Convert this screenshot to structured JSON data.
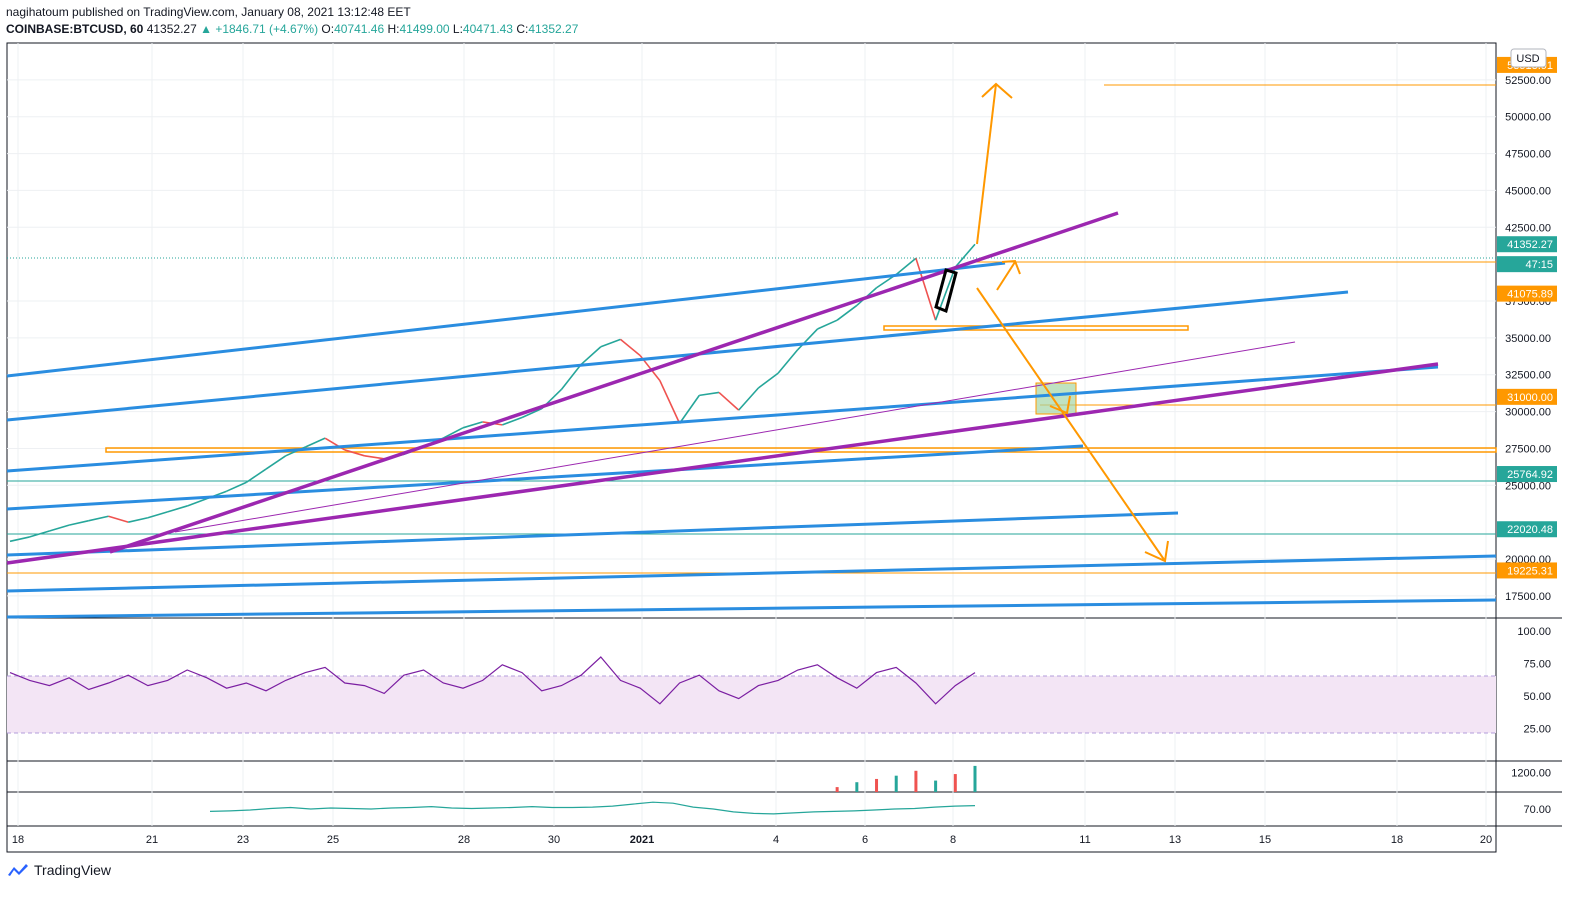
{
  "header": {
    "publisher": "nagihatoum published on TradingView.com, January 08, 2021 13:12:48 EET",
    "symbol": "COINBASE:BTCUSD, 60",
    "last": "41352.27",
    "change": "▲ +1846.71 (+4.67%)",
    "o_label": "O:",
    "o": "40741.46",
    "h_label": "H:",
    "h": "41499.00",
    "l_label": "L:",
    "l": "40471.43",
    "c_label": "C:",
    "c": "41352.27"
  },
  "currency_button": "USD",
  "footer": {
    "brand": "TradingView"
  },
  "colors": {
    "blue_line": "#2a8de0",
    "purple_line": "#9c27b0",
    "orange": "#ff9800",
    "green_teal": "#26a69a",
    "rsi_band": "#f3e5f5"
  },
  "chart_data": [
    {
      "type": "line",
      "panel": "price",
      "y_ticks": [
        "52500.00",
        "50000.00",
        "47500.00",
        "45000.00",
        "42500.00",
        "37500.00",
        "35000.00",
        "32500.00",
        "30000.00",
        "27500.00",
        "25000.00",
        "20000.00",
        "17500.00"
      ],
      "ylim": [
        16000,
        55000
      ],
      "price_labels": [
        {
          "text": "53513.91",
          "value": 53513.91,
          "color": "#ff9800"
        },
        {
          "text": "41352.27",
          "value": 41352.27,
          "color": "#26a69a"
        },
        {
          "text": "47:15",
          "value": 40000,
          "color": "#26a69a"
        },
        {
          "text": "41075.89",
          "value": 38000,
          "color": "#ff9800"
        },
        {
          "text": "31000.00",
          "value": 31000,
          "color": "#ff9800"
        },
        {
          "text": "25764.92",
          "value": 25764.92,
          "color": "#26a69a"
        },
        {
          "text": "22020.48",
          "value": 22020.48,
          "color": "#26a69a"
        },
        {
          "text": "19225.31",
          "value": 19225.31,
          "color": "#ff9800"
        }
      ],
      "x_ticks": [
        "18",
        "21",
        "23",
        "25",
        "28",
        "30",
        "2021",
        "4",
        "6",
        "8",
        "11",
        "13",
        "15",
        "18",
        "20"
      ],
      "series": [
        {
          "values": [
            21200,
            21500,
            21900,
            22300,
            22600,
            22900,
            22500,
            22800,
            23200,
            23600,
            24100,
            24600,
            25200,
            26100,
            27000,
            27600,
            28200,
            27400,
            27000,
            26800,
            27100,
            27600,
            28200,
            28900,
            29300,
            29100,
            29600,
            30200,
            31500,
            33200,
            34400,
            34900,
            33800,
            32100,
            29200,
            31100,
            31300,
            30100,
            31600,
            32600,
            34200,
            35600,
            36200,
            37200,
            38400,
            39300,
            40400,
            36200,
            39800,
            41352
          ]
        }
      ]
    },
    {
      "type": "line",
      "panel": "rsi",
      "y_ticks": [
        "100.00",
        "75.00",
        "50.00",
        "25.00"
      ],
      "ylim": [
        0,
        110
      ],
      "series": [
        {
          "values": [
            68,
            62,
            58,
            64,
            55,
            60,
            66,
            58,
            62,
            70,
            64,
            56,
            60,
            54,
            62,
            68,
            72,
            60,
            58,
            52,
            66,
            70,
            60,
            56,
            62,
            74,
            68,
            54,
            58,
            66,
            80,
            62,
            56,
            44,
            60,
            66,
            54,
            48,
            58,
            62,
            70,
            74,
            64,
            56,
            68,
            72,
            60,
            44,
            58,
            68
          ]
        }
      ]
    },
    {
      "type": "bar",
      "panel": "volume",
      "y_ticks": [
        "1200.00"
      ],
      "ylim": [
        0,
        1900
      ],
      "values": [
        0,
        0,
        0,
        0,
        0,
        0,
        0,
        0,
        0,
        0,
        0,
        0,
        0,
        0,
        0,
        0,
        0,
        0,
        0,
        0,
        0,
        0,
        0,
        0,
        0,
        0,
        0,
        0,
        0,
        0,
        0,
        0,
        0,
        0,
        0,
        0,
        0,
        0,
        0,
        0,
        0,
        0,
        300,
        600,
        800,
        1000,
        1300,
        700,
        1100,
        1600
      ]
    },
    {
      "type": "line",
      "panel": "oscillator",
      "y_ticks": [
        "70.00"
      ],
      "ylim": [
        0,
        140
      ],
      "series": [
        {
          "values": [
            60,
            62,
            66,
            72,
            76,
            70,
            74,
            72,
            70,
            74,
            76,
            80,
            74,
            72,
            74,
            76,
            80,
            76,
            76,
            78,
            82,
            90,
            98,
            94,
            78,
            70,
            58,
            52,
            50,
            54,
            58,
            60,
            62,
            66,
            70,
            72,
            78,
            82,
            84
          ]
        }
      ]
    }
  ]
}
